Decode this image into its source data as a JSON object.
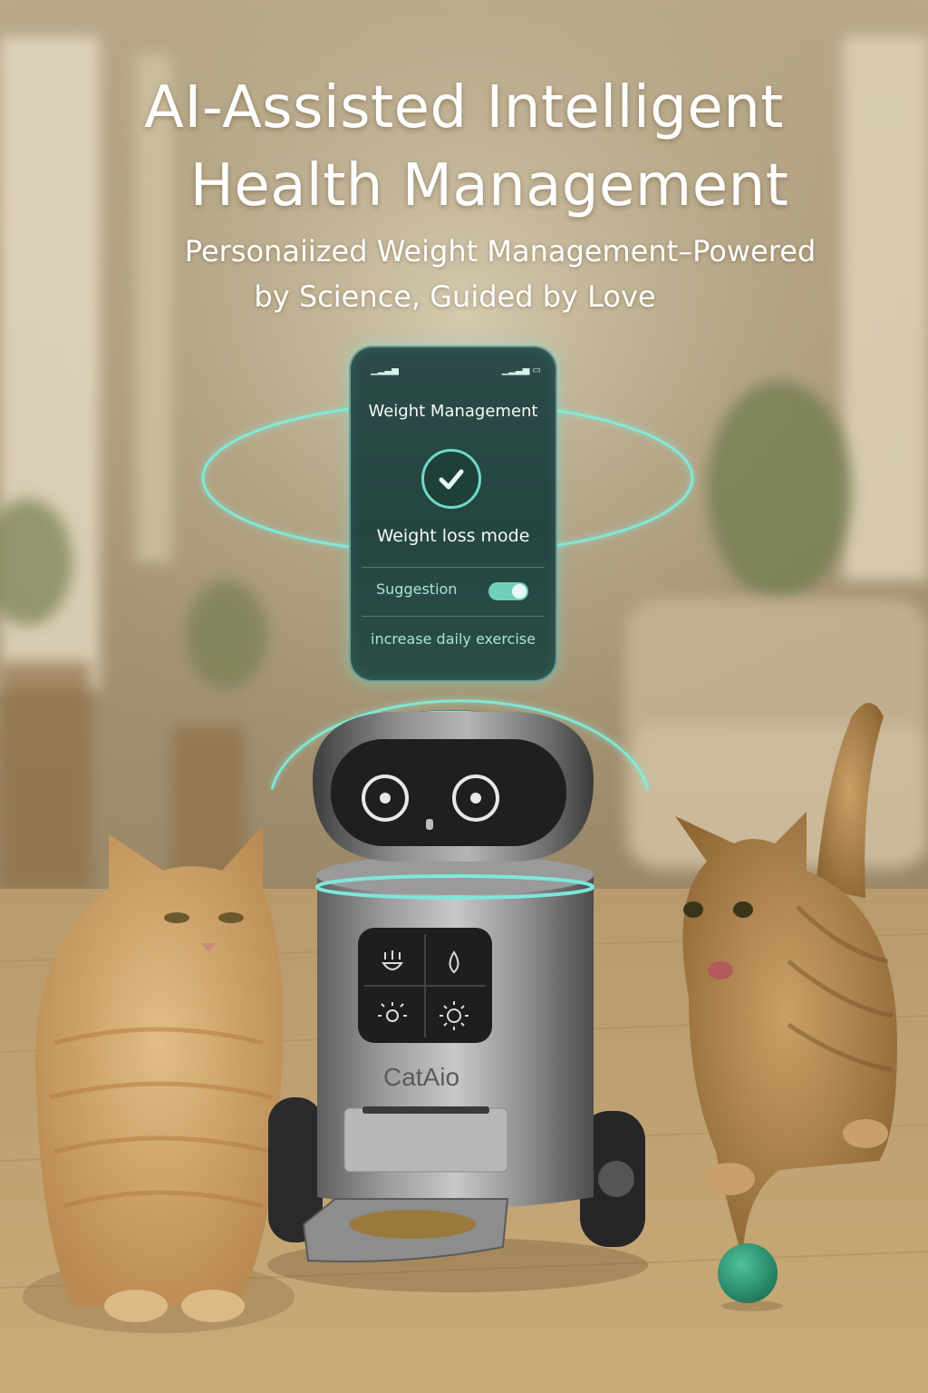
{
  "headline": {
    "line1": "AI-Assisted Intelligent",
    "line2": "Health Management"
  },
  "subheadline": {
    "line1": "Personaiized Weight Management–Powered",
    "line2": "by Science, Guided by Love"
  },
  "phone": {
    "title": "Weight Management",
    "mode": "Weight loss mode",
    "suggestion_label": "Suggestion",
    "suggestion_toggle_on": true,
    "suggestion_text": "increase daily exercise",
    "status_left": "▁▂▃▅",
    "status_right": "▁▂▃▅ ▭"
  },
  "robot": {
    "brand": "CatAio",
    "panel_icons": [
      "food-bowl-icon",
      "water-drop-icon",
      "light-dim-icon",
      "light-bright-icon"
    ]
  },
  "colors": {
    "accent_glow": "#6fe3d4",
    "phone_bg": "#27463f",
    "ball": "#2f8f6f"
  }
}
